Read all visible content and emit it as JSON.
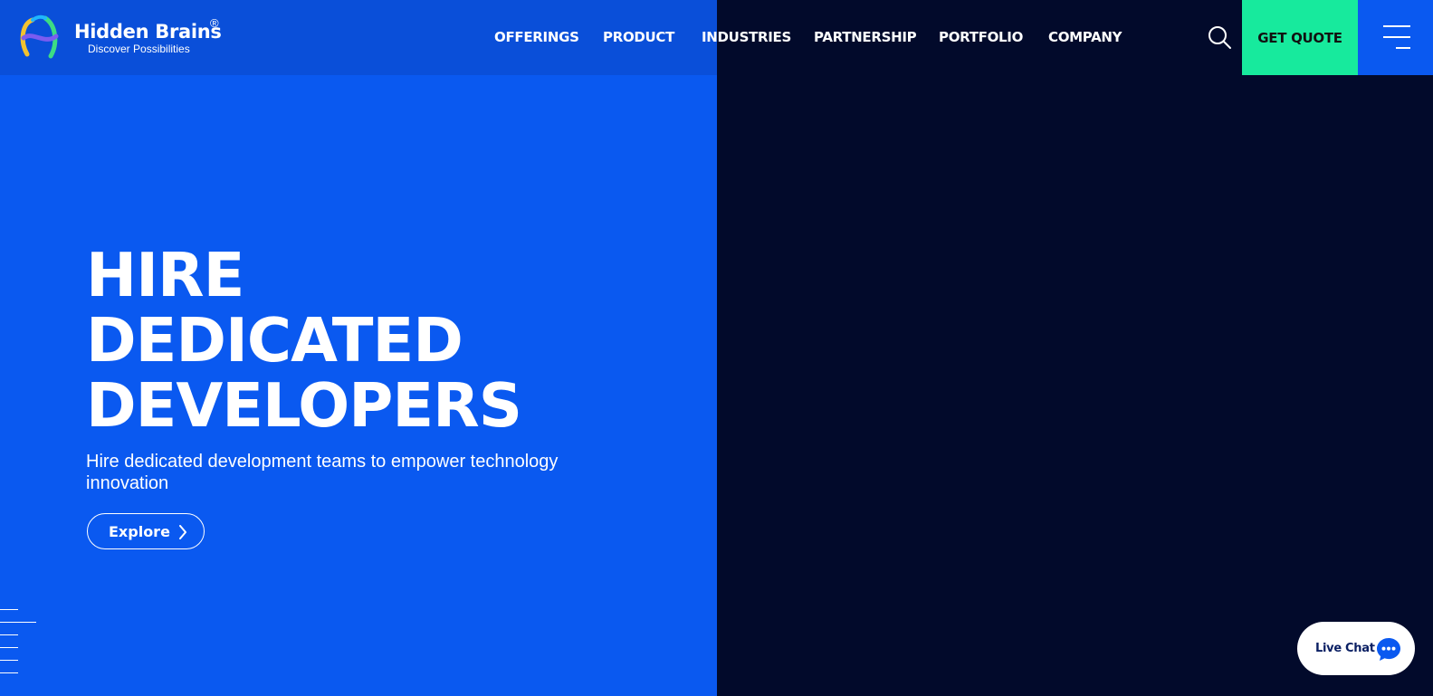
{
  "brand": {
    "name": "Hidden Brains",
    "registered": "®",
    "tagline": "Discover Possibilities"
  },
  "nav": {
    "items": [
      {
        "label": "OFFERINGS"
      },
      {
        "label": "PRODUCT"
      },
      {
        "label": "INDUSTRIES"
      },
      {
        "label": "PARTNERSHIP"
      },
      {
        "label": "PORTFOLIO"
      },
      {
        "label": "COMPANY"
      }
    ]
  },
  "header": {
    "search_icon": "search-icon",
    "quote_label": "GET QUOTE",
    "menu_icon": "menu-icon"
  },
  "hero": {
    "title_lines": [
      "HIRE",
      "DEDICATED",
      "DEVELOPERS"
    ],
    "subtitle": "Hire dedicated development teams to empower technology innovation",
    "cta_label": "Explore"
  },
  "chat": {
    "label": "Live Chat",
    "icon": "chat-bubble-icon"
  },
  "colors": {
    "primary_blue": "#0a59f0",
    "header_blue": "#0a4fd9",
    "dark_navy": "#020a2b",
    "quote_green": "#17ea9d",
    "chat_icon_blue": "#0a59f0"
  }
}
